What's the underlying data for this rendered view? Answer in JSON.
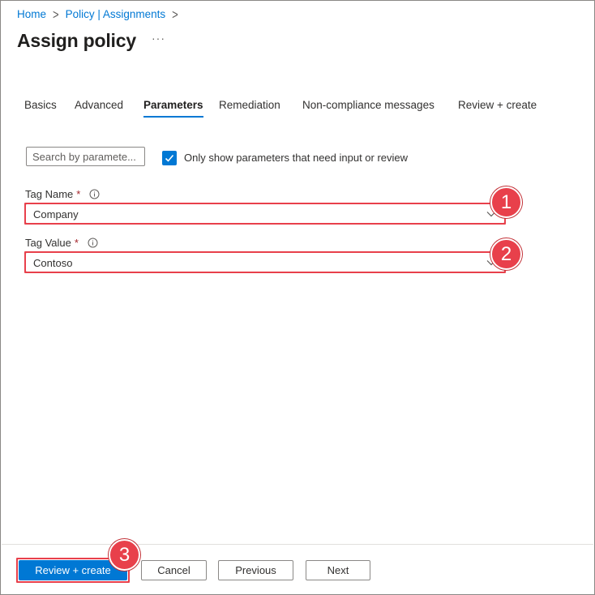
{
  "breadcrumb": {
    "items": [
      "Home",
      "Policy | Assignments"
    ]
  },
  "page": {
    "title": "Assign policy",
    "more_label": "···"
  },
  "tabs": [
    {
      "label": "Basics",
      "active": false
    },
    {
      "label": "Advanced",
      "active": false
    },
    {
      "label": "Parameters",
      "active": true
    },
    {
      "label": "Remediation",
      "active": false
    },
    {
      "label": "Non-compliance messages",
      "active": false
    },
    {
      "label": "Review + create",
      "active": false
    }
  ],
  "filter": {
    "search_placeholder": "Search by paramete...",
    "checkbox_label": "Only show parameters that need input or review",
    "checkbox_checked": true
  },
  "fields": {
    "tag_name": {
      "label": "Tag Name",
      "required_mark": "*",
      "value": "Company"
    },
    "tag_value": {
      "label": "Tag Value",
      "required_mark": "*",
      "value": "Contoso"
    }
  },
  "callouts": [
    "1",
    "2",
    "3"
  ],
  "footer": {
    "review_create": "Review + create",
    "cancel": "Cancel",
    "previous": "Previous",
    "next": "Next"
  },
  "colors": {
    "accent": "#0078d4",
    "highlight": "#e8404b",
    "required": "#a4262c"
  },
  "icons": {
    "breadcrumb_separator": "chevron-right-icon",
    "info": "info-icon",
    "dropdown": "chevron-down-icon",
    "checkbox": "checkmark-icon"
  }
}
